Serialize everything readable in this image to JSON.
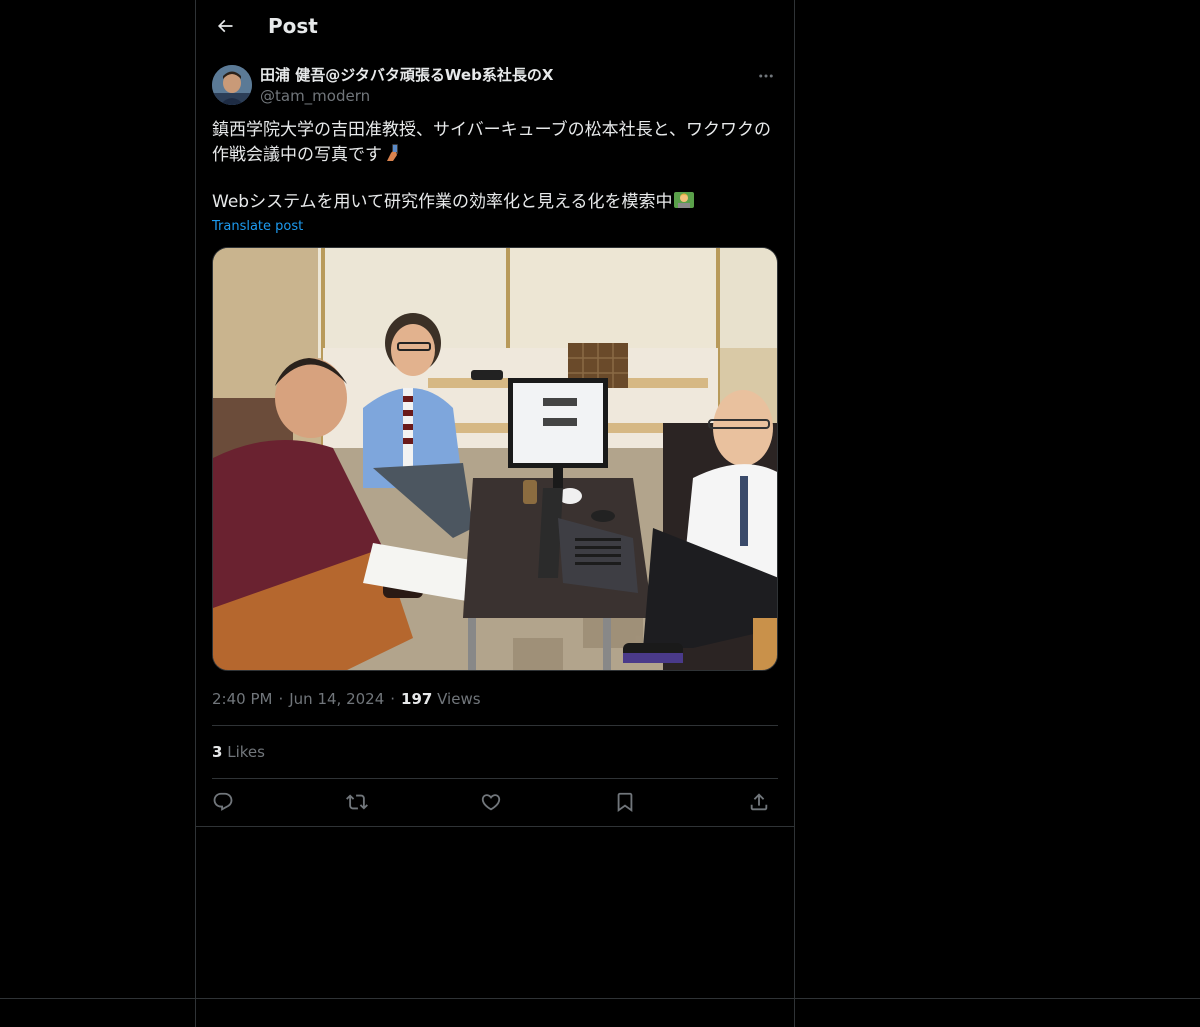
{
  "header": {
    "title": "Post",
    "back_icon": "arrow-left-icon"
  },
  "author": {
    "display_name": "田浦 健吾@ジタバタ頑張るWeb系社長のX",
    "handle": "@tam_modern",
    "more_icon": "more-horizontal-icon"
  },
  "post": {
    "line1": "鎮西学院大学の吉田准教授、サイバーキューブの松本社長と、ワクワクの",
    "line2": "作戦会議中の写真です",
    "line3": "Webシステムを用いて研究作業の効率化と見える化を模索中",
    "emoji1": "selfie-emoji",
    "emoji2": "person-with-laptop-emoji",
    "translate_label": "Translate post"
  },
  "meta": {
    "time": "2:40 PM",
    "separator": "·",
    "date": "Jun 14, 2024",
    "views_count": "197",
    "views_label": "Views"
  },
  "stats": {
    "likes_count": "3",
    "likes_label": "Likes"
  },
  "actions": [
    {
      "name": "reply",
      "icon": "reply-icon"
    },
    {
      "name": "repost",
      "icon": "repost-icon"
    },
    {
      "name": "like",
      "icon": "heart-icon"
    },
    {
      "name": "bookmark",
      "icon": "bookmark-icon"
    },
    {
      "name": "share",
      "icon": "share-icon"
    }
  ],
  "colors": {
    "background": "#000000",
    "text": "#e7e9ea",
    "secondary": "#71767b",
    "link": "#1d9bf0",
    "border": "#2f3336"
  }
}
